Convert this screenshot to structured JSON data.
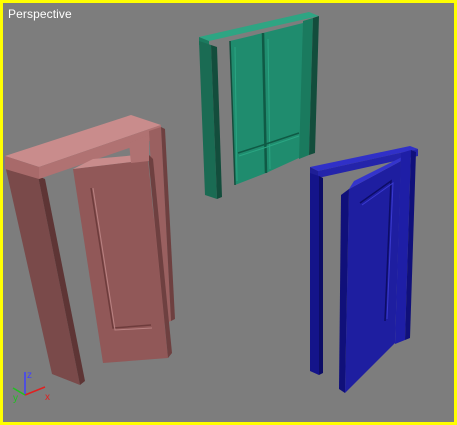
{
  "viewport": {
    "label": "Perspective",
    "border_color": "#ffff00",
    "background_color": "#7d7d7d"
  },
  "objects": [
    {
      "name": "pink-door",
      "color": "#c08080"
    },
    {
      "name": "green-door",
      "color": "#1f8c6e"
    },
    {
      "name": "blue-door",
      "color": "#1e1ea0"
    }
  ],
  "axis": {
    "x_label": "x",
    "y_label": "y",
    "z_label": "z",
    "x_color": "#e02020",
    "y_color": "#20c020",
    "z_color": "#4040ff"
  }
}
